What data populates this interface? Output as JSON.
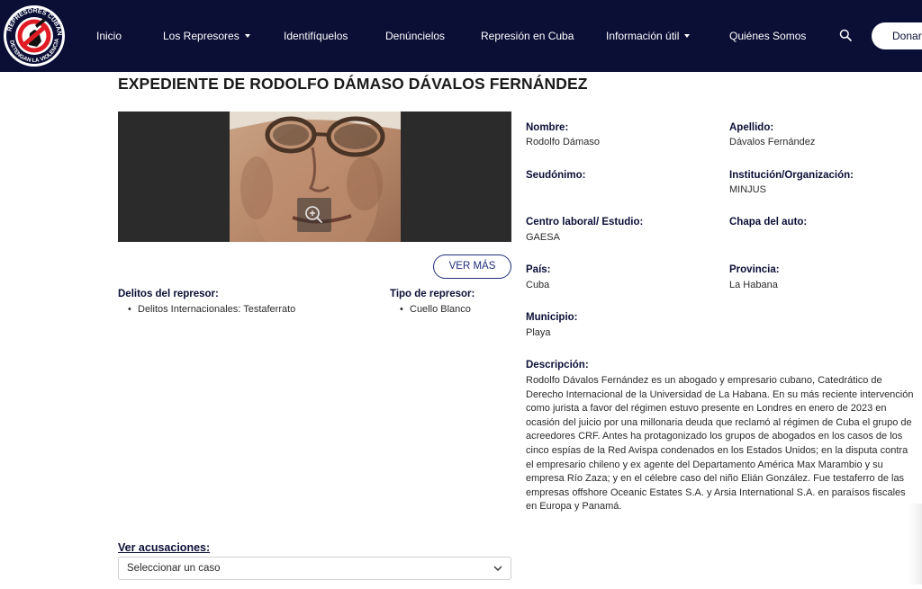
{
  "header": {
    "logo_alt": "Represores Cubanos – Detengan la Violencia",
    "nav": [
      {
        "label": "Inicio",
        "dropdown": false
      },
      {
        "label": "Los Represores",
        "dropdown": true
      },
      {
        "label": "Identifíquelos",
        "dropdown": false
      },
      {
        "label": "Denúncielos",
        "dropdown": false
      },
      {
        "label": "Represión en Cuba",
        "dropdown": false
      },
      {
        "label": "Información útil",
        "dropdown": true
      },
      {
        "label": "Quiénes Somos",
        "dropdown": false
      }
    ],
    "search_icon": "search-icon",
    "donate_label": "Donar"
  },
  "title": "EXPEDIENTE DE RODOLFO DÁMASO DÁVALOS FERNÁNDEZ",
  "photo": {
    "zoom_icon": "zoom-in-icon"
  },
  "ver_mas_label": "VER MÁS",
  "delitos": {
    "label": "Delitos del represor:",
    "items": [
      "Delitos Internacionales: Testaferrato"
    ]
  },
  "tipo": {
    "label": "Tipo de represor:",
    "items": [
      "Cuello Blanco"
    ]
  },
  "fields": {
    "nombre": {
      "label": "Nombre:",
      "value": "Rodolfo Dámaso"
    },
    "apellido": {
      "label": "Apellido:",
      "value": "Dávalos Fernández"
    },
    "seudonimo": {
      "label": "Seudónimo:",
      "value": ""
    },
    "institucion": {
      "label": "Institución/Organización:",
      "value": "MINJUS"
    },
    "centro": {
      "label": "Centro laboral/ Estudio:",
      "value": "GAESA"
    },
    "chapa": {
      "label": "Chapa del auto:",
      "value": ""
    },
    "pais": {
      "label": "País:",
      "value": "Cuba"
    },
    "provincia": {
      "label": "Provincia:",
      "value": "La Habana"
    },
    "municipio": {
      "label": "Municipio:",
      "value": "Playa"
    }
  },
  "descripcion": {
    "label": "Descripción:",
    "text": "Rodolfo Dávalos Fernández es un abogado y empresario cubano, Catedrático de Derecho Internacional de la Universidad de La Habana. En su más reciente intervención como jurista a favor del régimen estuvo presente en Londres en enero de 2023 en ocasión del juicio por una millonaria deuda que reclamó al régimen de Cuba el grupo de acreedores CRF. Antes ha protagonizado los grupos de abogados en los casos de los cinco espías de la Red Avispa condenados en los Estados Unidos; en la disputa contra el empresario chileno y ex agente del Departamento América Max Marambio y su empresa Río Zaza; y en el célebre caso del niño Elián González. Fue testaferro de las empresas offshore Oceanic Estates S.A. y Arsia International S.A. en paraísos fiscales en Europa y Panamá."
  },
  "acusaciones": {
    "label": "Ver acusaciones:",
    "selected": "Seleccionar un caso"
  }
}
